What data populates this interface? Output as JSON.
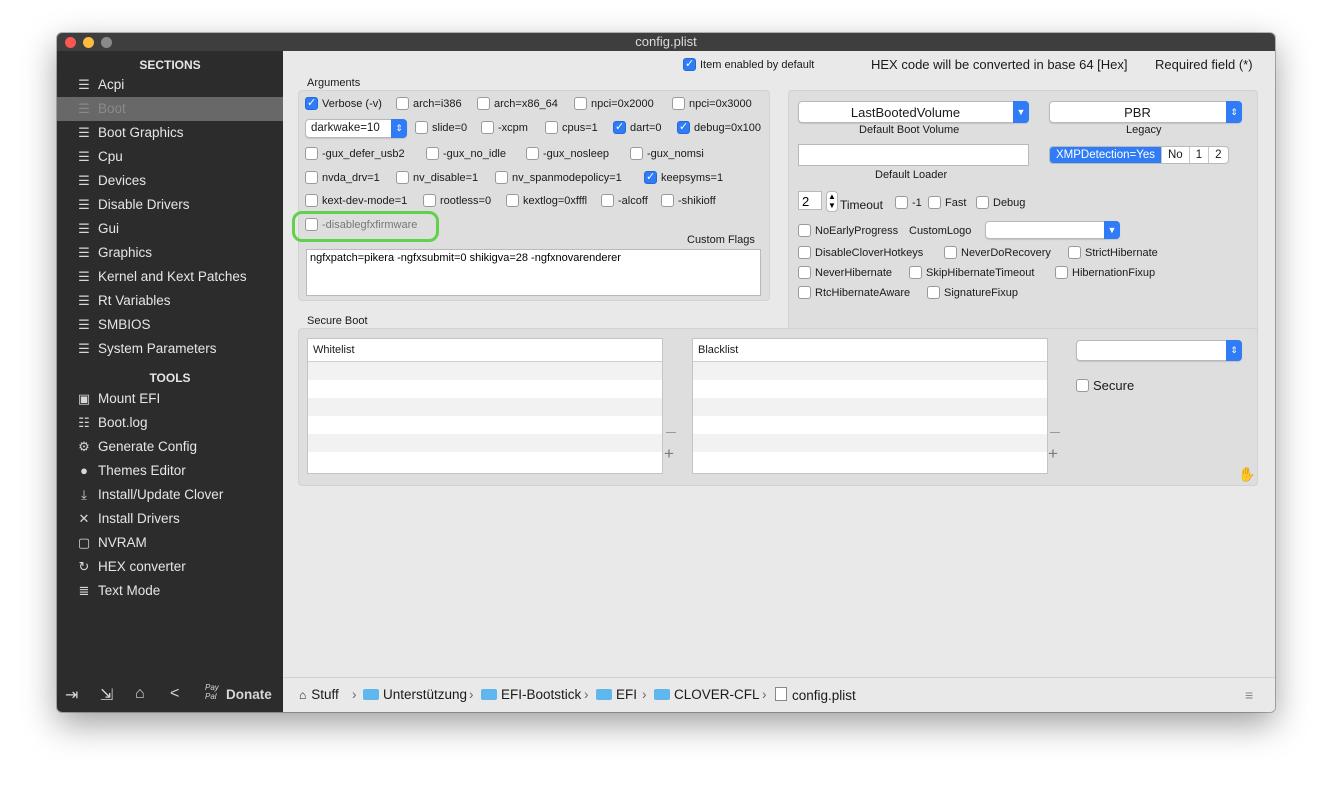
{
  "window": {
    "title": "config.plist"
  },
  "sidebar": {
    "sections_heading": "SECTIONS",
    "sections": [
      {
        "label": "Acpi"
      },
      {
        "label": "Boot"
      },
      {
        "label": "Boot Graphics"
      },
      {
        "label": "Cpu"
      },
      {
        "label": "Devices"
      },
      {
        "label": "Disable Drivers"
      },
      {
        "label": "Gui"
      },
      {
        "label": "Graphics"
      },
      {
        "label": "Kernel and Kext Patches"
      },
      {
        "label": "Rt Variables"
      },
      {
        "label": "SMBIOS"
      },
      {
        "label": "System Parameters"
      }
    ],
    "selected": "Boot",
    "tools_heading": "TOOLS",
    "tools": [
      {
        "label": "Mount EFI",
        "icon": "disk-icon"
      },
      {
        "label": "Boot.log",
        "icon": "log-search-icon"
      },
      {
        "label": "Generate Config",
        "icon": "gears-icon"
      },
      {
        "label": "Themes Editor",
        "icon": "palette-icon"
      },
      {
        "label": "Install/Update Clover",
        "icon": "download-icon"
      },
      {
        "label": "Install Drivers",
        "icon": "tools-icon"
      },
      {
        "label": "NVRAM",
        "icon": "chip-icon"
      },
      {
        "label": "HEX converter",
        "icon": "refresh-icon"
      },
      {
        "label": "Text Mode",
        "icon": "text-lines-icon"
      }
    ],
    "footer": {
      "donate_label": "Donate",
      "paypal_text": "Pay Pal"
    }
  },
  "header": {
    "item_enabled": "Item enabled by default",
    "hex_note": "HEX code will be converted in base 64 [Hex]",
    "required": "Required field (*)"
  },
  "arguments": {
    "section_label": "Arguments",
    "row1": [
      {
        "label": "Verbose (-v)",
        "checked": true
      },
      {
        "label": "arch=i386",
        "checked": false
      },
      {
        "label": "arch=x86_64",
        "checked": false
      },
      {
        "label": "npci=0x2000",
        "checked": false
      },
      {
        "label": "npci=0x3000",
        "checked": false
      }
    ],
    "darkwake_value": "darkwake=10",
    "row2": [
      {
        "label": "slide=0",
        "checked": false
      },
      {
        "label": "-xcpm",
        "checked": false
      },
      {
        "label": "cpus=1",
        "checked": false
      },
      {
        "label": "dart=0",
        "checked": true
      },
      {
        "label": "debug=0x100",
        "checked": true
      }
    ],
    "row3": [
      {
        "label": "-gux_defer_usb2",
        "checked": false
      },
      {
        "label": "-gux_no_idle",
        "checked": false
      },
      {
        "label": "-gux_nosleep",
        "checked": false
      },
      {
        "label": "-gux_nomsi",
        "checked": false
      }
    ],
    "row4": [
      {
        "label": "nvda_drv=1",
        "checked": false
      },
      {
        "label": "nv_disable=1",
        "checked": false
      },
      {
        "label": "nv_spanmodepolicy=1",
        "checked": false
      },
      {
        "label": "keepsyms=1",
        "checked": true
      }
    ],
    "row5": [
      {
        "label": "kext-dev-mode=1",
        "checked": false
      },
      {
        "label": "rootless=0",
        "checked": false
      },
      {
        "label": "kextlog=0xfffl",
        "checked": false
      },
      {
        "label": "-alcoff",
        "checked": false
      },
      {
        "label": "-shikioff",
        "checked": false
      }
    ],
    "disablegfx": {
      "label": "-disablegfxfirmware",
      "checked": false
    },
    "custom_flags_label": "Custom Flags",
    "custom_flags_value": "ngfxpatch=pikera -ngfxsubmit=0 shikigva=28 -ngfxnovarenderer"
  },
  "boot_options": {
    "default_volume_value": "LastBootedVolume",
    "default_volume_label": "Default Boot Volume",
    "legacy_value": "PBR",
    "legacy_label": "Legacy",
    "default_loader_label": "Default Loader",
    "default_loader_value": "",
    "xmp_segments": [
      "XMPDetection=Yes",
      "No",
      "1",
      "2"
    ],
    "xmp_selected": "XMPDetection=Yes",
    "timeout_value": "2",
    "timeout_label": "Timeout",
    "timeout_checks": [
      {
        "label": "-1",
        "checked": false
      },
      {
        "label": "Fast",
        "checked": false
      },
      {
        "label": "Debug",
        "checked": false
      }
    ],
    "no_early_progress": "NoEarlyProgress",
    "custom_logo_label": "CustomLogo",
    "flags_row1": [
      "DisableCloverHotkeys",
      "NeverDoRecovery",
      "StrictHibernate"
    ],
    "flags_row2": [
      "NeverHibernate",
      "SkipHibernateTimeout",
      "HibernationFixup"
    ],
    "flags_row3": [
      "RtcHibernateAware",
      "SignatureFixup"
    ]
  },
  "secure_boot": {
    "section_label": "Secure Boot",
    "whitelist_header": "Whitelist",
    "blacklist_header": "Blacklist",
    "secure_label": "Secure"
  },
  "pathbar": {
    "items": [
      {
        "label": "Stuff"
      },
      {
        "label": "Unterstützung"
      },
      {
        "label": "EFI-Bootstick"
      },
      {
        "label": "EFI"
      },
      {
        "label": "CLOVER-CFL"
      },
      {
        "label": "config.plist"
      }
    ],
    "separator": "›"
  },
  "colors": {
    "accent": "#2f7cf6",
    "highlight_ring": "#5fd14b",
    "sidebar_bg": "#2c2c2c"
  }
}
